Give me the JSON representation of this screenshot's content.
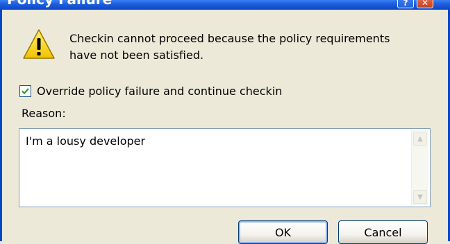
{
  "window": {
    "title": "Policy Failure",
    "help_label": "?",
    "close_label": "✕"
  },
  "dialog": {
    "message_line1": "Checkin cannot proceed because the policy requirements",
    "message_line2": "have not been satisfied.",
    "override_checkbox": {
      "label": "Override policy failure and continue checkin",
      "checked": true
    },
    "reason_label": "Reason:",
    "reason_value": "I'm a lousy developer",
    "ok_label": "OK",
    "cancel_label": "Cancel"
  },
  "colors": {
    "titlebar": "#0a46c8",
    "dialog_bg": "#ece9d8",
    "warning_yellow": "#f9d81d",
    "check_green": "#21a121"
  }
}
